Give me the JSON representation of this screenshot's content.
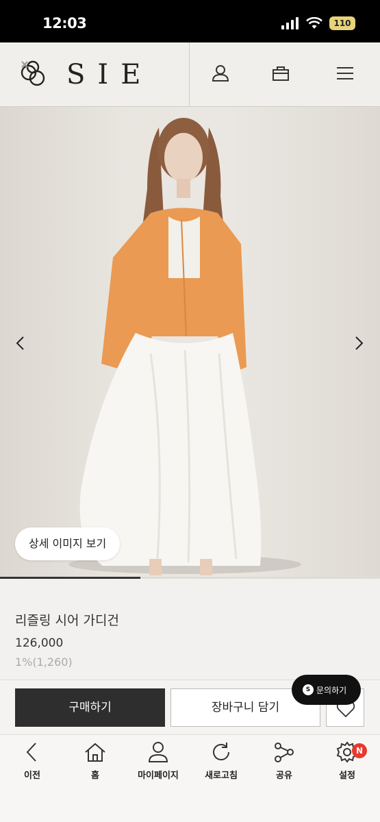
{
  "status_bar": {
    "time": "12:03",
    "battery": "110"
  },
  "header": {
    "brand": "SIE"
  },
  "hero": {
    "detail_button": "상세 이미지 보기",
    "slide_progress": 0.37
  },
  "product": {
    "name": "리즐링 시어 가디건",
    "price": "126,000",
    "points": "1%(1,260)"
  },
  "actions": {
    "buy": "구매하기",
    "cart": "장바구니 담기"
  },
  "inquiry": {
    "label": "문의하기",
    "logo_text": "S"
  },
  "tabbar": {
    "items": [
      {
        "label": "이전"
      },
      {
        "label": "홈"
      },
      {
        "label": "마이페이지"
      },
      {
        "label": "새로고침"
      },
      {
        "label": "공유"
      },
      {
        "label": "설정"
      }
    ],
    "settings_badge": "N"
  }
}
